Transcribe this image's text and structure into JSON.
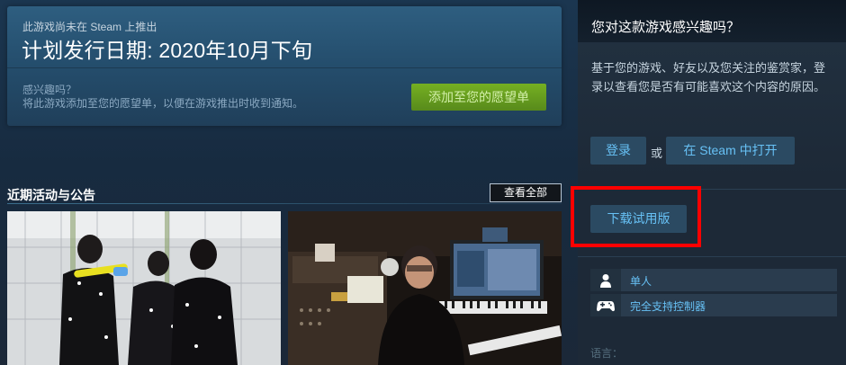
{
  "coming_soon": {
    "not_released_text": "此游戏尚未在 Steam 上推出",
    "release_date_text": "计划发行日期: 2020年10月下旬",
    "interest_title": "感兴趣吗？",
    "interest_desc": "将此游戏添加至您的愿望单，以便在游戏推出时收到通知。",
    "wishlist_button": "添加至您的愿望单"
  },
  "news": {
    "title": "近期活动与公告",
    "view_all_button": "查看全部"
  },
  "sidebar": {
    "header_title": "您对这款游戏感兴趣吗？",
    "description": "基于您的游戏、好友以及您关注的鉴赏家，登录以查看您是否有可能喜欢这个内容的原因。",
    "login_button": "登录",
    "or_text": "或",
    "open_in_steam_button": "在 Steam 中打开",
    "download_demo_button": "下载试用版",
    "features": [
      {
        "icon": "single-player-icon",
        "label": "单人"
      },
      {
        "icon": "controller-icon",
        "label": "完全支持控制器"
      }
    ],
    "languages_label": "语言："
  },
  "colors": {
    "accent_link": "#67c1f5",
    "wishlist_green": "#75b022",
    "highlight_red": "#ff0000"
  }
}
